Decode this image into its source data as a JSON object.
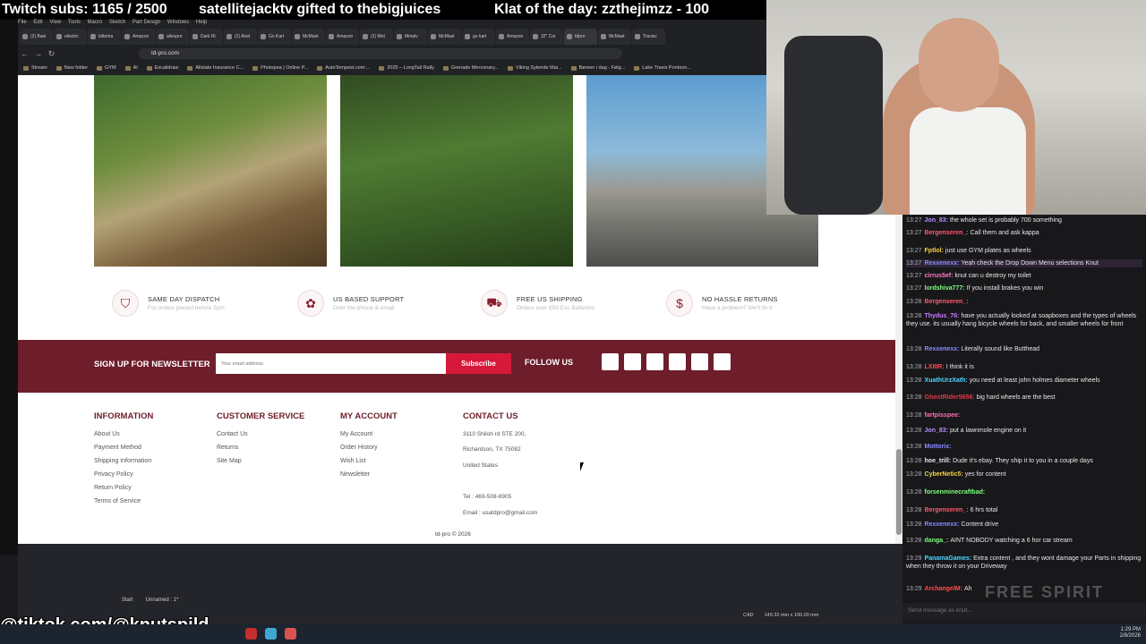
{
  "overlay": {
    "subs": "Twitch subs: 1165 / 2500",
    "gifted": "satellitejacktv gifted to thebigjuices",
    "klat": "Klat of the day: zzthejimzz - 100",
    "tiktok": "@tiktok.com/@knutspild"
  },
  "browser": {
    "menu": [
      "File",
      "Edit",
      "View",
      "Tools",
      "Macro",
      "Sketch",
      "Part Design",
      "Windows",
      "Help"
    ],
    "tabs": [
      "(2) Basi",
      "electric",
      "biltema",
      "Amazon",
      "aliexpre",
      "Dark Ri",
      "(2) Ariel",
      "Go Kart",
      "McMast",
      "Amazon",
      "(2) Mot",
      "Metalv",
      "McMast",
      "go kart",
      "Amazon",
      "32\" Cor",
      "tdpro",
      "McMast",
      "Travisc"
    ],
    "url": "td-pro.com",
    "bookmarks": [
      "Stream",
      "New folder",
      "GYM",
      "AI",
      "Excalidraw",
      "Allstate Insurance C...",
      "Photopea | Online P...",
      "AutoTempest.com:...",
      "2025 – LongTail Rally",
      "Grenade Mercenary...",
      "Viking Sytende Mai...",
      "Børsen i dag - Følg...",
      "Lake Travis Pontoon..."
    ]
  },
  "features": [
    {
      "title": "SAME DAY DISPATCH",
      "sub": "For orders placed before 2pm",
      "icon": "shield-icon",
      "glyph": "⛉"
    },
    {
      "title": "US BASED SUPPORT",
      "sub": "Over the phone & email",
      "icon": "support-icon",
      "glyph": "✿"
    },
    {
      "title": "FREE US SHIPPING",
      "sub": "Orders over £50 Exc Batteries",
      "icon": "truck-icon",
      "glyph": "⛟"
    },
    {
      "title": "NO HASSLE RETURNS",
      "sub": "Have a problem? We'll fix it",
      "icon": "returns-icon",
      "glyph": "$"
    }
  ],
  "newsletter": {
    "title": "SIGN UP FOR NEWSLETTER",
    "placeholder": "Your email address",
    "button": "Subscribe",
    "follow": "FOLLOW US"
  },
  "footer": {
    "information": {
      "title": "INFORMATION",
      "links": [
        "About Us",
        "Payment Method",
        "Shipping Information",
        "Privacy Policy",
        "Return Policy",
        "Terms of Service"
      ]
    },
    "customer_service": {
      "title": "CUSTOMER SERVICE",
      "links": [
        "Contact Us",
        "Returns",
        "Site Map"
      ]
    },
    "my_account": {
      "title": "MY ACCOUNT",
      "links": [
        "My Account",
        "Order History",
        "Wish List",
        "Newsletter"
      ]
    },
    "contact": {
      "title": "CONTACT US",
      "address1": "3110 Shiloh rd STE 200,",
      "address2": "Richardson,   TX 75082",
      "country": "United States",
      "tel": "Tel : 469-508-6905",
      "email": "Email : usatdpro@gmail.com"
    },
    "copyright": "td-pro © 2026"
  },
  "cad": {
    "tabs": [
      "Start",
      "Unnamed : 1*"
    ],
    "status": [
      "CAD",
      "149.32 mm x 100.00 mm"
    ]
  },
  "chat": {
    "lines": [
      {
        "ts": "13:27",
        "user": "Jon_83:",
        "color": "#b98cff",
        "text": "the whole set is probably 700 something"
      },
      {
        "ts": "13:27",
        "user": "Bergenseren_:",
        "color": "#ff5a6e",
        "text": "Call them and ask kappa"
      },
      {
        "ts": "13:27",
        "user": "Fptlol:",
        "color": "#f5d442",
        "text": "just use GYM plates as wheels"
      },
      {
        "ts": "13:27",
        "user": "Rexxenexx:",
        "color": "#8a8cff",
        "text": "Yeah check the Drop Down Menu selections Knut"
      },
      {
        "ts": "13:27",
        "user": "cirrus5ef:",
        "color": "#ff7ac6",
        "text": "knut can u destroy my toilet"
      },
      {
        "ts": "13:27",
        "user": "lordshiva777:",
        "color": "#7cff7c",
        "text": "If you install brakes you win"
      },
      {
        "ts": "13:28",
        "user": "Bergenseren_:",
        "color": "#ff5a6e",
        "text": ""
      },
      {
        "ts": "13:28",
        "user": "Thydus_76:",
        "color": "#c77cff",
        "text": "have you actually looked at soapboxes and the types of wheels they use. its usually hang bicycle wheels for back, and smaller wheels for front"
      },
      {
        "ts": "13:28",
        "user": "Rexxenexx:",
        "color": "#8a8cff",
        "text": "Literally sound like Butthead"
      },
      {
        "ts": "13:28",
        "user": "LXIIIR:",
        "color": "#ff4d4d",
        "text": "I think it is"
      },
      {
        "ts": "13:28",
        "user": "XuathUrzXath:",
        "color": "#4dd6ff",
        "text": "you need at least john holmes diameter wheels"
      },
      {
        "ts": "13:28",
        "user": "GhostRider5656:",
        "color": "#e63946",
        "text": "big hard wheels are the best"
      },
      {
        "ts": "13:28",
        "user": "fartpisspee:",
        "color": "#ff6fb5",
        "text": ""
      },
      {
        "ts": "13:28",
        "user": "Jon_83:",
        "color": "#b98cff",
        "text": "put a lawnmole engine on it"
      },
      {
        "ts": "13:28",
        "user": "Mottorix:",
        "color": "#8a8cff",
        "text": ""
      },
      {
        "ts": "13:28",
        "user": "hoe_trill:",
        "color": "#e8e8ea",
        "text": "Dude it's ebay. They ship it to you in a couple days"
      },
      {
        "ts": "13:28",
        "user": "CyberNetic5:",
        "color": "#f5d442",
        "text": "yes for content"
      },
      {
        "ts": "13:28",
        "user": "forsenminecraftbad:",
        "color": "#7cff7c",
        "text": ""
      },
      {
        "ts": "13:28",
        "user": "Bergenseren_:",
        "color": "#ff5a6e",
        "text": "6 hrs total"
      },
      {
        "ts": "13:28",
        "user": "Rexxenexx:",
        "color": "#8a8cff",
        "text": "Content drive"
      },
      {
        "ts": "13:28",
        "user": "danga_:",
        "color": "#7cff7c",
        "text": "AINT NOBODY watching a 6 hor car stream"
      },
      {
        "ts": "13:29",
        "user": "PanamaGames:",
        "color": "#4dd6ff",
        "text": "Extra content      , and they wont damage your Parts in shipping when they throw it on your Driveway"
      },
      {
        "ts": "13:29",
        "user": "ArchangelM:",
        "color": "#ff4d4d",
        "text": "Ah"
      }
    ],
    "input_placeholder": "Send message as knut...",
    "watermark": "FREE SPIRIT"
  },
  "taskbar": {
    "time": "1:29 PM",
    "date": "2/8/2026"
  }
}
